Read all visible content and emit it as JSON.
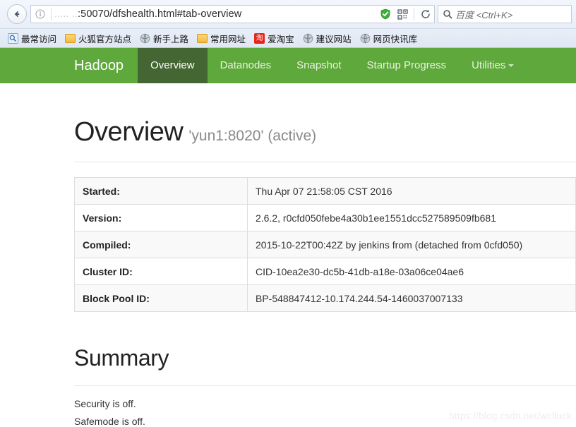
{
  "browser": {
    "back_icon": "back-arrow-icon",
    "identity_icon": "info-icon",
    "url_host_masked": ".....   ..",
    "url_rest": ":50070/dfshealth.html#tab-overview",
    "shield_icon": "green-shield-check-icon",
    "qr_icon": "qr-code-icon",
    "reload_icon": "reload-icon",
    "search_icon": "search-icon",
    "search_placeholder": "百度 <Ctrl+K>",
    "bookmarks": [
      {
        "label": "最常访问",
        "icon": "most-visited-icon"
      },
      {
        "label": "火狐官方站点",
        "icon": "folder-icon"
      },
      {
        "label": "新手上路",
        "icon": "globe-icon"
      },
      {
        "label": "常用网址",
        "icon": "folder-icon"
      },
      {
        "label": "爱淘宝",
        "icon": "taobao-icon"
      },
      {
        "label": "建议网站",
        "icon": "globe-icon"
      },
      {
        "label": "网页快讯库",
        "icon": "globe-icon"
      }
    ]
  },
  "navbar": {
    "brand": "Hadoop",
    "items": [
      {
        "label": "Overview",
        "active": true,
        "caret": false
      },
      {
        "label": "Datanodes",
        "active": false,
        "caret": false
      },
      {
        "label": "Snapshot",
        "active": false,
        "caret": false
      },
      {
        "label": "Startup Progress",
        "active": false,
        "caret": false
      },
      {
        "label": "Utilities",
        "active": false,
        "caret": true
      }
    ],
    "bg_color": "#5fa83c",
    "active_bg_color": "#446633"
  },
  "overview": {
    "title": "Overview",
    "subtitle": "'yun1:8020' (active)",
    "rows": [
      {
        "key": "Started:",
        "value": "Thu Apr 07 21:58:05 CST 2016"
      },
      {
        "key": "Version:",
        "value": "2.6.2, r0cfd050febe4a30b1ee1551dcc527589509fb681"
      },
      {
        "key": "Compiled:",
        "value": "2015-10-22T00:42Z by jenkins from (detached from 0cfd050)"
      },
      {
        "key": "Cluster ID:",
        "value": "CID-10ea2e30-dc5b-41db-a18e-03a06ce04ae6"
      },
      {
        "key": "Block Pool ID:",
        "value": "BP-548847412-10.174.244.54-1460037007133"
      }
    ]
  },
  "summary": {
    "title": "Summary",
    "lines": [
      "Security is off.",
      "Safemode is off."
    ]
  },
  "watermark": "https://blog.csdn.net/wclluck"
}
